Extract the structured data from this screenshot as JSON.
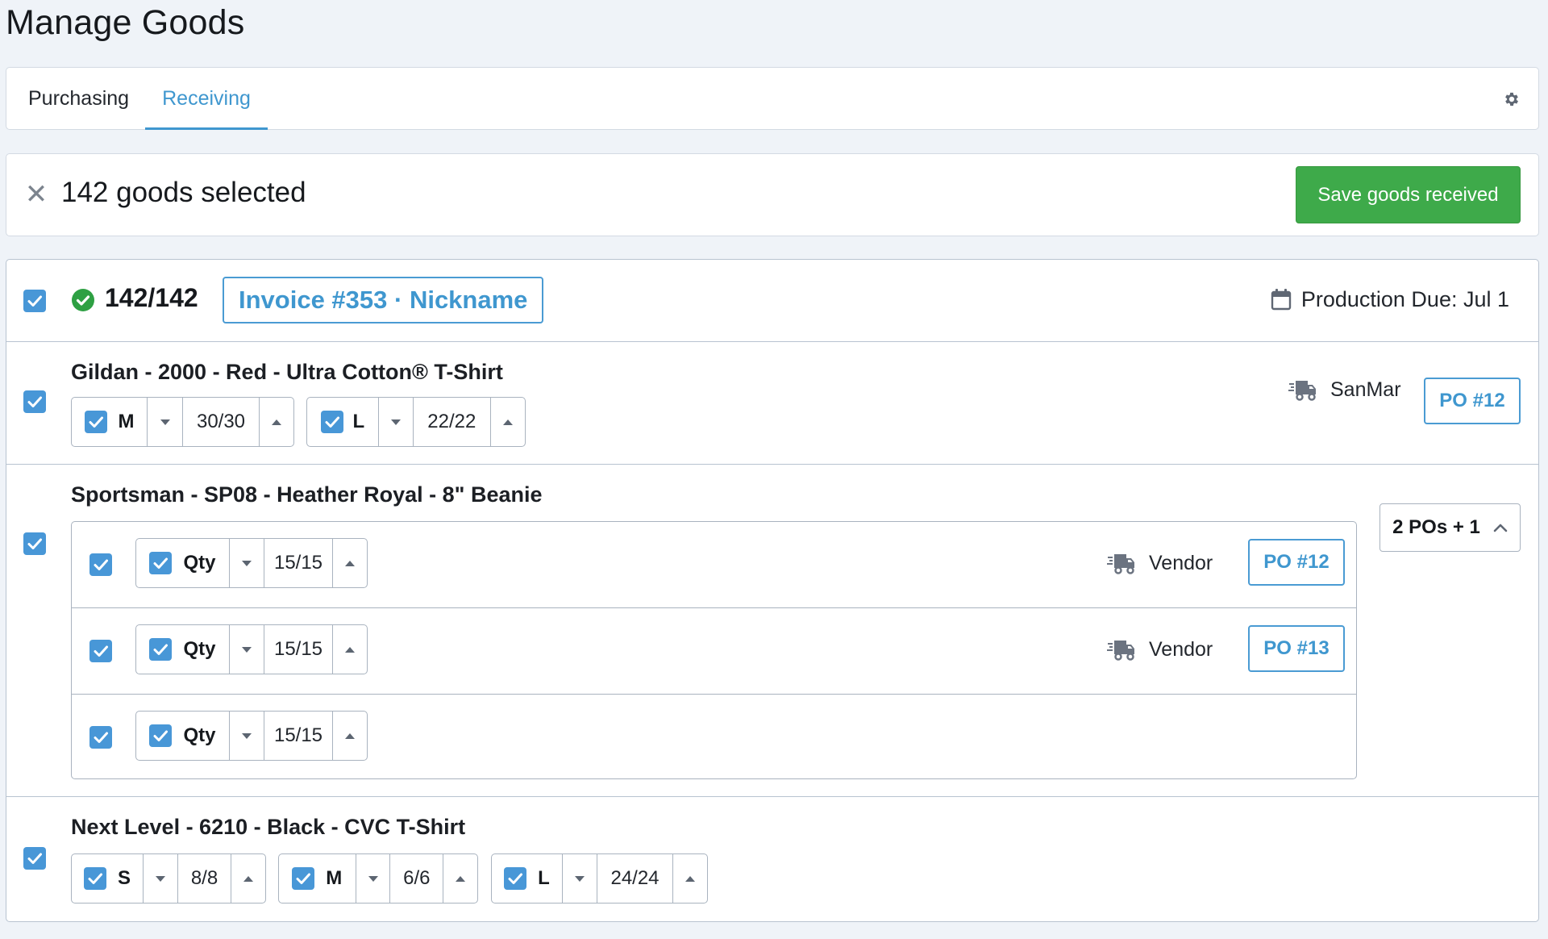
{
  "page": {
    "title": "Manage Goods"
  },
  "tabs": [
    {
      "label": "Purchasing",
      "active": false
    },
    {
      "label": "Receiving",
      "active": true
    }
  ],
  "selection": {
    "count_text": "142 goods selected",
    "save_label": "Save goods received"
  },
  "order": {
    "received_count": "142/142",
    "invoice_label": "Invoice #353 · Nickname",
    "production_due": "Production Due: Jul 1"
  },
  "items": [
    {
      "title": "Gildan - 2000 - Red - Ultra Cotton® T-Shirt",
      "vendor": "SanMar",
      "po": "PO #12",
      "variants": [
        {
          "label": "M",
          "qty": "30/30"
        },
        {
          "label": "L",
          "qty": "22/22"
        }
      ]
    },
    {
      "title": "Sportsman - SP08 - Heather Royal - 8\" Beanie",
      "pos_summary": "2 POs + 1",
      "lines": [
        {
          "label": "Qty",
          "qty": "15/15",
          "vendor": "Vendor",
          "po": "PO #12"
        },
        {
          "label": "Qty",
          "qty": "15/15",
          "vendor": "Vendor",
          "po": "PO #13"
        },
        {
          "label": "Qty",
          "qty": "15/15"
        }
      ]
    },
    {
      "title": "Next Level - 6210 - Black - CVC T-Shirt",
      "variants": [
        {
          "label": "S",
          "qty": "8/8"
        },
        {
          "label": "M",
          "qty": "6/6"
        },
        {
          "label": "L",
          "qty": "24/24"
        }
      ]
    }
  ],
  "colors": {
    "accent": "#3f97cf",
    "checkbox": "#4897d7",
    "success": "#3eaa4a",
    "border": "#b8c3d0"
  },
  "icons": [
    "gear-icon",
    "close-icon",
    "check-circle-icon",
    "calendar-icon",
    "truck-icon",
    "chevron-up-icon",
    "caret-down-icon",
    "caret-up-icon",
    "checkbox-icon"
  ]
}
